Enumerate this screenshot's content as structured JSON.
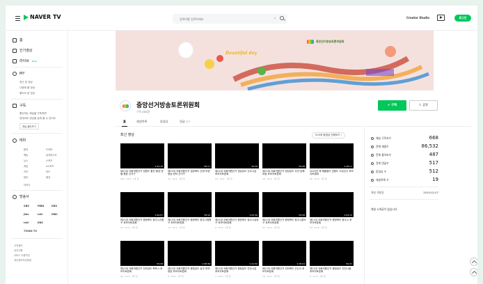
{
  "header": {
    "logo_text": "NAVER TV",
    "search_placeholder": "검색어를 입력하세요",
    "creator_studio": "Creator Studio",
    "login_label": "로그인"
  },
  "sidebar": {
    "home": "홈",
    "popular": "인기영상",
    "live": "라이브",
    "live_badge": "Beta",
    "my": "MY",
    "my_items": [
      "최근 본 영상",
      "나중에 볼 영상",
      "좋아요 한 영상"
    ],
    "subscribe": "구독",
    "subscribe_desc": [
      "좋아하는 채널을 구독하면",
      "업데이트 영상을 쉽게 볼 수 있어요"
    ],
    "subscribe_btn": "채널 둘러보기",
    "theme": "테마",
    "theme_items": [
      "음악",
      "드라마",
      "예능",
      "뮤직비디오",
      "뉴스",
      "스포츠",
      "게임",
      "e스포츠",
      "키즈",
      "푸드",
      "뷰티",
      "패션"
    ],
    "theme_more": "더보기",
    "broadcast": "방송사",
    "broadcasters": [
      "SBS",
      "MBN",
      "KBS",
      "jtbc",
      "tvN",
      "MBC",
      "tvN",
      "EBS",
      "TVING TV"
    ],
    "footer": [
      "고객센터",
      "공지사항",
      "서비스 이용약관",
      "개인정보처리방침"
    ]
  },
  "channel": {
    "name": "중앙선거방송토론위원회",
    "subscribers": "구독 668명",
    "subscribe_button": "+ 구독",
    "share_button": "공유",
    "banner_text": "중앙선거방송토론위원회",
    "banner_tagline": "Beautiful day"
  },
  "tabs": [
    {
      "label": "홈",
      "count": ""
    },
    {
      "label": "재생목록",
      "count": ""
    },
    {
      "label": "동영상",
      "count": ""
    },
    {
      "label": "댓글",
      "count": "517"
    }
  ],
  "videos_section": {
    "title": "최신 영상",
    "playlist_button": "519개 동영상 전체보기"
  },
  "videos": [
    {
      "title": "제21대 국회의원선거 강원도 홍천·횡성·영월·평창 선거구",
      "meta": "210 · 12.9 · 1주 전",
      "dur": "1:42:16",
      "c1": "#2a5d8f",
      "c2": "#9ac3e6"
    },
    {
      "title": "제21대 국회의원선거 경상북도 군위·의성·청송·영덕 선거구",
      "meta": "16 · 12.9 · 1주 전",
      "dur": "58:17",
      "c1": "#1d3c78",
      "c2": "#6fa0d8"
    },
    {
      "title": "제21대 국회의원선거 경상남도 진주시갑 후보자토론회",
      "meta": "24 · 12.9 · 1주 전",
      "dur": "59:58",
      "c1": "#10244a",
      "c2": "#4a7fc0"
    },
    {
      "title": "제21대 국회의원선거 경상남도 사천·남해·하동 후보자토론회",
      "meta": "18 · 12.9 · 1주 전",
      "dur": "59:08",
      "c1": "#cfe2f5",
      "c2": "#5a8ac4"
    },
    {
      "title": "2020년 제 해볼렐거 강원도 고성군수 후보자토론회",
      "meta": "30 · 12.9 · 1주 전",
      "dur": "1:28:11",
      "c1": "#2f6bb1",
      "c2": "#a8cdee"
    },
    {
      "title": "제21대 국회의원선거 충청북도 청주시서원구 후보자토론회",
      "meta": "15 · 12.9 · 1주 전",
      "dur": "1:06:07",
      "c1": "#111",
      "c2": "#6a3a8a"
    },
    {
      "title": "제21대 국회의원선거 충청북도 청주시청원구 후보자토론회",
      "meta": "12 · 12.9 · 1주 전",
      "dur": "58:34",
      "c1": "#1a2d5a",
      "c2": "#507bbf"
    },
    {
      "title": "제21대 국회의원선거 충청북도 청주시상당구 후보자토론회",
      "meta": "9 · 12.9 · 1주 전",
      "dur": "1:03:36",
      "c1": "#222",
      "c2": "#7d5b9b"
    },
    {
      "title": "제21대 국회의원선거 충청북도 청주시흥덕구 후보자토론회",
      "meta": "11 · 12.9 · 1주 전",
      "dur": "59:58",
      "c1": "#333",
      "c2": "#5e6a9a"
    },
    {
      "title": "제21대 국회의원선거 충청북도 충주시 후보자토론회",
      "meta": "14 · 12.9 · 1주 전",
      "dur": "1:04:13",
      "c1": "#1b1b2b",
      "c2": "#806fb5"
    },
    {
      "title": "제21대 국회의원선거 전라남도 목포시 후보자토론회",
      "meta": "20 · 12.9 · 1주 전",
      "dur": "59:28",
      "c1": "#221a2e",
      "c2": "#6a3f90"
    },
    {
      "title": "제21대 국회의원선거 충청남도 공주·부여·청양 후보자토론회",
      "meta": "8 · 12.9 · 1주 전",
      "dur": "1:28:38",
      "c1": "#1c2f5c",
      "c2": "#406bb5"
    },
    {
      "title": "제21대 국회의원선거 충청남도 천안시갑 후보자토론회",
      "meta": "7 · 12.9 · 1주 전",
      "dur": "1:21:50",
      "c1": "#111",
      "c2": "#3d6db8"
    },
    {
      "title": "제21대 국회의원선거 전라북도 군산시 후보자토론회",
      "meta": "10 · 12.9 · 1주 전",
      "dur": "1:28:24",
      "c1": "#050505",
      "c2": "#3a3a3a"
    },
    {
      "title": "제21대 국회의원선거 충청남도 천안시을 후보자토론회",
      "meta": "6 · 12.9 · 1주 전",
      "dur": "59:47",
      "c1": "#222",
      "c2": "#6b3d9a"
    }
  ],
  "stats": {
    "items": [
      {
        "label": "채널 구독자수",
        "value": "668"
      },
      {
        "label": "전체 재생수",
        "value": "86,532"
      },
      {
        "label": "전체 좋아요수",
        "value": "487"
      },
      {
        "label": "전체 댓글수",
        "value": "517"
      },
      {
        "label": "동영상 수",
        "value": "512"
      },
      {
        "label": "재생목록 수",
        "value": "19"
      }
    ],
    "created_label": "채널 개설일",
    "created_date": "2020.02.07",
    "no_intro": "채널 소개글이 없습니다."
  }
}
